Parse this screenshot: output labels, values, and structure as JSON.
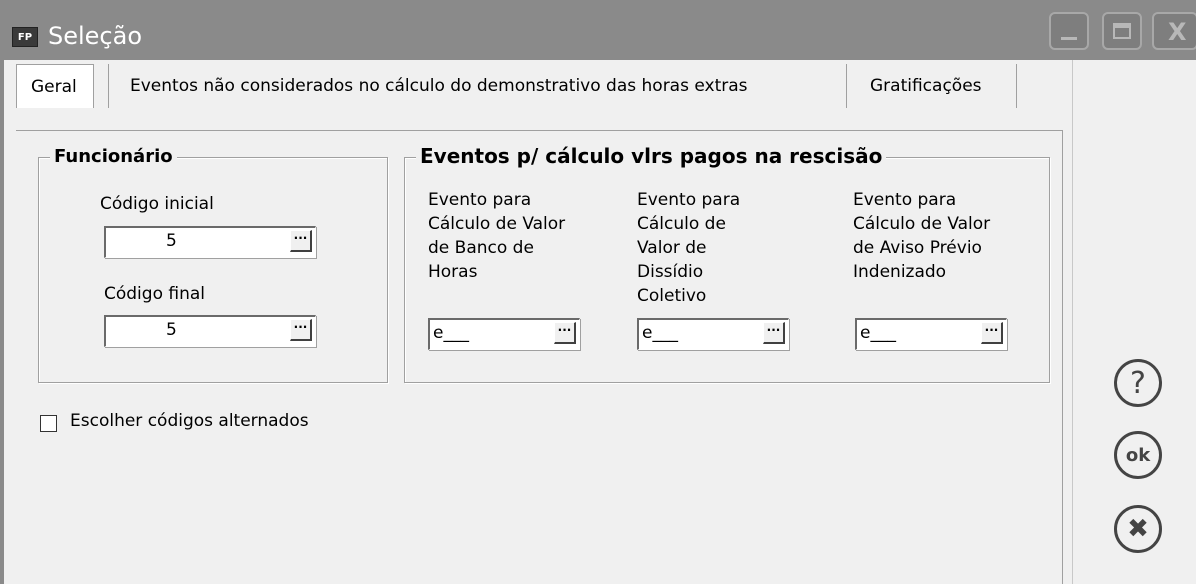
{
  "window": {
    "icon_text": "FP",
    "title": "Seleção"
  },
  "titlebar_buttons": {
    "close_glyph": "X"
  },
  "tabs": [
    {
      "label": "Geral"
    },
    {
      "label": "Eventos não considerados no cálculo do demonstrativo das horas extras"
    },
    {
      "label": "Gratificações"
    }
  ],
  "funcionario": {
    "legend": "Funcionário",
    "codigo_inicial_label": "Código inicial",
    "codigo_inicial_value": "5",
    "codigo_final_label": "Código final",
    "codigo_final_value": "5",
    "dots": "···"
  },
  "eventos": {
    "legend": "Eventos p/ cálculo vlrs pagos na rescisão",
    "banco_horas_label": [
      "Evento para",
      "Cálculo de Valor",
      "de Banco de",
      "Horas"
    ],
    "banco_horas_value": "e___",
    "dissidio_label": [
      "Evento para",
      "Cálculo de",
      "Valor de",
      "Dissídio",
      "Coletivo"
    ],
    "dissidio_value": "e___",
    "aviso_previo_label": [
      "Evento para",
      "Cálculo de Valor",
      "de Aviso Prévio",
      "Indenizado"
    ],
    "aviso_previo_value": "e___"
  },
  "options": {
    "escolher_codigos_label": "Escolher códigos alternados"
  },
  "side_buttons": {
    "help_glyph": "?",
    "ok_glyph": "ok",
    "cancel_glyph": "✖"
  }
}
